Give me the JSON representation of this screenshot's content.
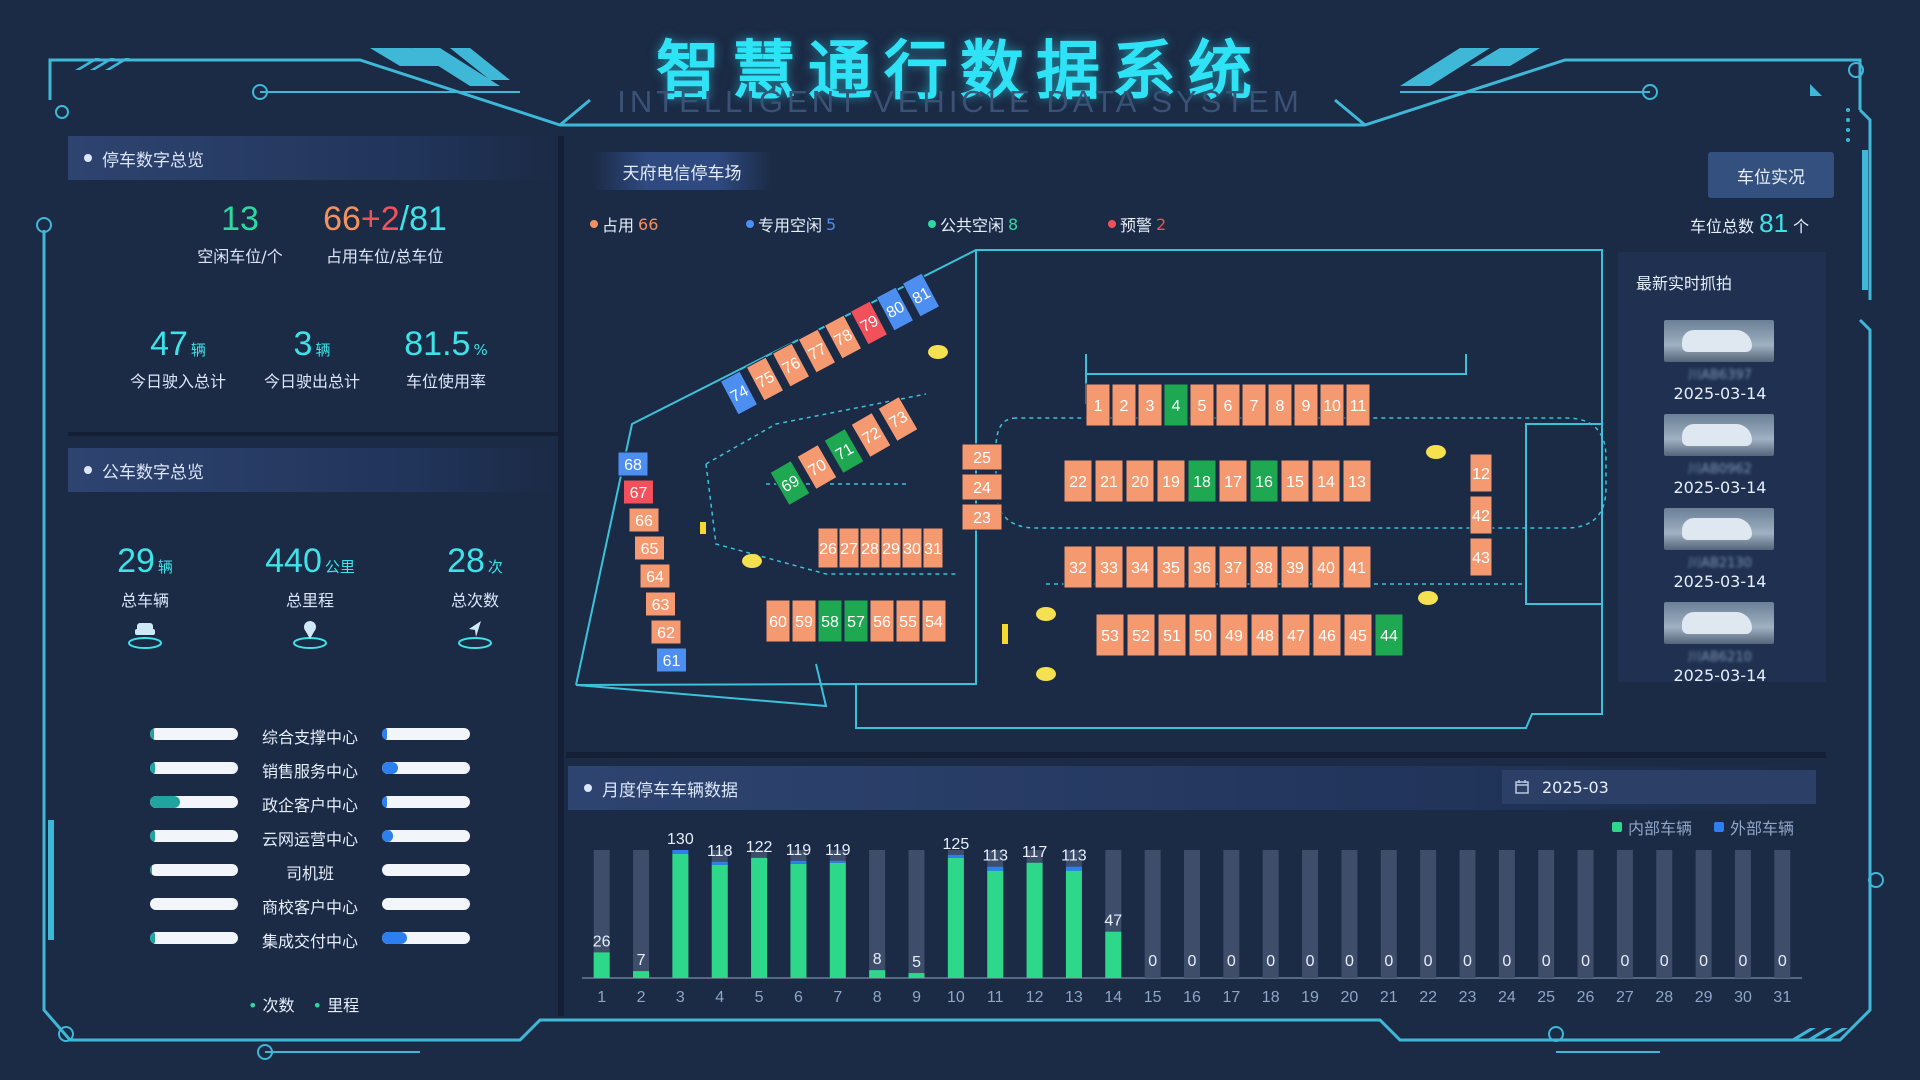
{
  "header": {
    "title": "智慧通行数据系统",
    "subtitle": "INTELLIGENT VEHICLE DATA SYSTEM"
  },
  "parking_overview": {
    "panel_title": "停车数字总览",
    "free": {
      "value": "13",
      "label": "空闲车位/个"
    },
    "occupied": {
      "occupied": "66",
      "plus": "+2",
      "slash": "/",
      "total": "81",
      "label": "占用车位/总车位"
    },
    "entered": {
      "value": "47",
      "unit": "辆",
      "label": "今日驶入总计"
    },
    "exited": {
      "value": "3",
      "unit": "辆",
      "label": "今日驶出总计"
    },
    "usage": {
      "value": "81.5",
      "unit": "%",
      "label": "车位使用率"
    }
  },
  "bus_overview": {
    "panel_title": "公车数字总览",
    "vehicles": {
      "value": "29",
      "unit": "辆",
      "label": "总车辆"
    },
    "mileage": {
      "value": "440",
      "unit": "公里",
      "label": "总里程"
    },
    "trips": {
      "value": "28",
      "unit": "次",
      "label": "总次数"
    },
    "departments": [
      {
        "name": "综合支撑中心",
        "trips": 0.04,
        "mileage": 0.06
      },
      {
        "name": "销售服务中心",
        "trips": 0.06,
        "mileage": 0.18
      },
      {
        "name": "政企客户中心",
        "trips": 0.34,
        "mileage": 0.06
      },
      {
        "name": "云网运营中心",
        "trips": 0.06,
        "mileage": 0.12
      },
      {
        "name": "司机班",
        "trips": 0.02,
        "mileage": 0.0
      },
      {
        "name": "商校客户中心",
        "trips": 0.0,
        "mileage": 0.0
      },
      {
        "name": "集成交付中心",
        "trips": 0.06,
        "mileage": 0.28
      }
    ],
    "legend": {
      "trips": "次数",
      "mileage": "里程"
    }
  },
  "parking_map": {
    "lot_name": "天府电信停车场",
    "realtime_button": "车位实况",
    "legend": [
      {
        "label": "占用",
        "value": "66",
        "color": "#f5915f"
      },
      {
        "label": "专用空闲",
        "value": "5",
        "color": "#4d8ff0"
      },
      {
        "label": "公共空闲",
        "value": "8",
        "color": "#2ed8a0"
      },
      {
        "label": "预警",
        "value": "2",
        "color": "#f2505a"
      }
    ],
    "total": {
      "label": "车位总数",
      "value": "81",
      "unit": "个"
    },
    "spot_colors": {
      "occupied": "#f59a70",
      "free": "#1ea851",
      "dedicated": "#4d8ff0",
      "alert": "#f2505a"
    },
    "top_row": [
      "1",
      "2",
      "3",
      "4",
      "5",
      "6",
      "7",
      "8",
      "9",
      "10",
      "11"
    ],
    "row_b": [
      "22",
      "21",
      "20",
      "19",
      "18",
      "17",
      "16",
      "15",
      "14",
      "13"
    ],
    "row_c": [
      "32",
      "33",
      "34",
      "35",
      "36",
      "37",
      "38",
      "39",
      "40",
      "41"
    ],
    "row_d": [
      "53",
      "52",
      "51",
      "50",
      "49",
      "48",
      "47",
      "46",
      "45",
      "44"
    ],
    "mid_col": [
      "25",
      "24",
      "23"
    ],
    "mid_row": [
      "26",
      "27",
      "28",
      "29",
      "30",
      "31"
    ],
    "bottom_row": [
      "60",
      "59",
      "58",
      "57",
      "56",
      "55",
      "54"
    ],
    "right_col": [
      "12",
      "42",
      "43"
    ],
    "left_col": [
      "68",
      "67",
      "66",
      "65",
      "64",
      "63",
      "62",
      "61"
    ],
    "diag_top": [
      "74",
      "75",
      "76",
      "77",
      "78",
      "79",
      "80",
      "81"
    ],
    "diag_mid": [
      "69",
      "70",
      "71",
      "72",
      "73"
    ],
    "free_spots": [
      "4",
      "18",
      "16",
      "44",
      "58",
      "57",
      "69",
      "71"
    ],
    "dedicated_spots": [
      "74",
      "80",
      "81",
      "68",
      "61"
    ],
    "alert_spots": [
      "79",
      "67"
    ]
  },
  "snapshots": {
    "title": "最新实时抓拍",
    "items": [
      {
        "plate": "川AB6397",
        "date": "2025-03-14"
      },
      {
        "plate": "川AB0962",
        "date": "2025-03-14"
      },
      {
        "plate": "川AB2130",
        "date": "2025-03-14"
      },
      {
        "plate": "川AB6210",
        "date": "2025-03-14"
      }
    ]
  },
  "monthly": {
    "panel_title": "月度停车车辆数据",
    "month": "2025-03",
    "calendar_icon": "calendar-icon"
  },
  "chart_data": {
    "type": "bar",
    "title": "月度停车车辆数据",
    "categories": [
      "1",
      "2",
      "3",
      "4",
      "5",
      "6",
      "7",
      "8",
      "9",
      "10",
      "11",
      "12",
      "13",
      "14",
      "15",
      "16",
      "17",
      "18",
      "19",
      "20",
      "21",
      "22",
      "23",
      "24",
      "25",
      "26",
      "27",
      "28",
      "29",
      "30",
      "31"
    ],
    "series": [
      {
        "name": "内部车辆",
        "color": "#2ed88a",
        "values": [
          26,
          7,
          126,
          115,
          122,
          116,
          117,
          8,
          5,
          122,
          109,
          117,
          109,
          47,
          0,
          0,
          0,
          0,
          0,
          0,
          0,
          0,
          0,
          0,
          0,
          0,
          0,
          0,
          0,
          0,
          0
        ]
      },
      {
        "name": "外部车辆",
        "color": "#2d7ff0",
        "values": [
          0,
          0,
          4,
          3,
          0,
          3,
          2,
          0,
          0,
          3,
          4,
          0,
          4,
          0,
          0,
          0,
          0,
          0,
          0,
          0,
          0,
          0,
          0,
          0,
          0,
          0,
          0,
          0,
          0,
          0,
          0
        ]
      }
    ],
    "totals": [
      26,
      7,
      130,
      118,
      122,
      119,
      119,
      8,
      5,
      125,
      113,
      117,
      113,
      47,
      0,
      0,
      0,
      0,
      0,
      0,
      0,
      0,
      0,
      0,
      0,
      0,
      0,
      0,
      0,
      0,
      0
    ],
    "ylim": [
      0,
      130
    ],
    "grid": false,
    "legend": "top-right"
  }
}
